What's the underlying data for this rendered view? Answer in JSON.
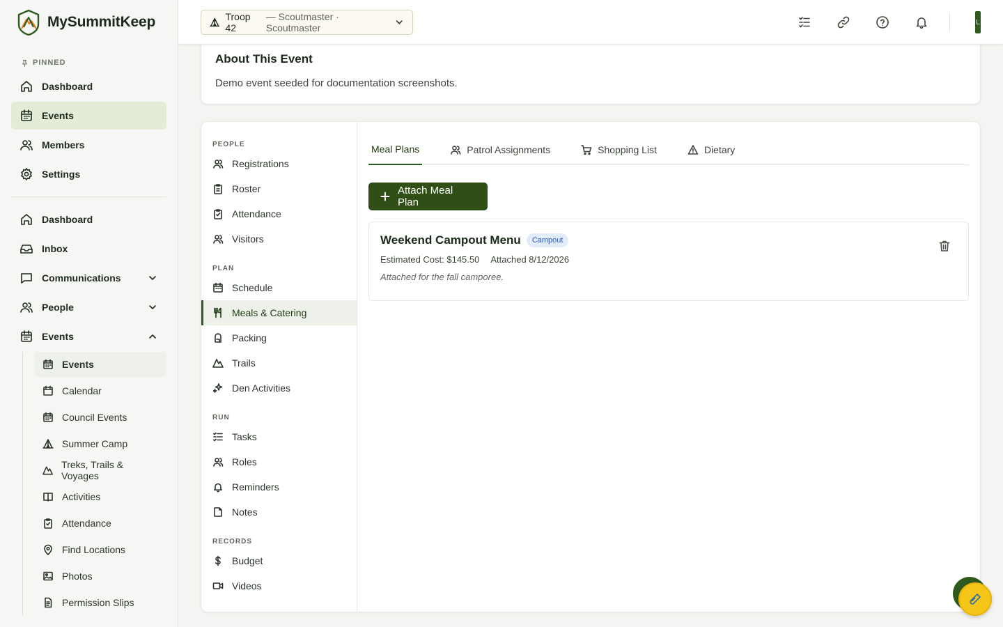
{
  "brand": {
    "name": "MySummitKeep"
  },
  "sidebar": {
    "pinned_label": "PINNED",
    "pinned": [
      {
        "label": "Dashboard",
        "icon": "home-icon"
      },
      {
        "label": "Events",
        "icon": "calendar-icon"
      },
      {
        "label": "Members",
        "icon": "users-icon"
      },
      {
        "label": "Settings",
        "icon": "gear-icon"
      }
    ],
    "main": [
      {
        "label": "Dashboard",
        "icon": "home-icon"
      },
      {
        "label": "Inbox",
        "icon": "inbox-icon"
      },
      {
        "label": "Communications",
        "icon": "message-icon"
      },
      {
        "label": "People",
        "icon": "users-icon"
      },
      {
        "label": "Events",
        "icon": "calendar-icon"
      }
    ],
    "events_sub": [
      {
        "label": "Events",
        "icon": "calendar-grid-icon"
      },
      {
        "label": "Calendar",
        "icon": "calendar-icon"
      },
      {
        "label": "Council Events",
        "icon": "calendar-grid-icon"
      },
      {
        "label": "Summer Camp",
        "icon": "tent-icon"
      },
      {
        "label": "Treks, Trails & Voyages",
        "icon": "mountain-icon"
      },
      {
        "label": "Activities",
        "icon": "book-icon"
      },
      {
        "label": "Attendance",
        "icon": "clipboard-check-icon"
      },
      {
        "label": "Find Locations",
        "icon": "map-pin-icon"
      },
      {
        "label": "Photos",
        "icon": "image-icon"
      },
      {
        "label": "Permission Slips",
        "icon": "document-icon"
      }
    ]
  },
  "topbar": {
    "troop": "Troop 42",
    "role": "— Scoutmaster · Scoutmaster",
    "avatar_initial": "L"
  },
  "about": {
    "title": "About This Event",
    "description": "Demo event seeded for documentation screenshots."
  },
  "event_nav": {
    "sections": [
      {
        "label": "PEOPLE",
        "items": [
          "Registrations",
          "Roster",
          "Attendance",
          "Visitors"
        ]
      },
      {
        "label": "PLAN",
        "items": [
          "Schedule",
          "Meals & Catering",
          "Packing",
          "Trails",
          "Den Activities"
        ]
      },
      {
        "label": "RUN",
        "items": [
          "Tasks",
          "Roles",
          "Reminders",
          "Notes"
        ]
      },
      {
        "label": "RECORDS",
        "items": [
          "Budget",
          "Videos"
        ]
      }
    ]
  },
  "tabs": [
    "Meal Plans",
    "Patrol Assignments",
    "Shopping List",
    "Dietary"
  ],
  "attach_button": "Attach Meal Plan",
  "meal_plan": {
    "title": "Weekend Campout Menu",
    "badge": "Campout",
    "cost": "Estimated Cost: $145.50",
    "attached": "Attached 8/12/2026",
    "note": "Attached for the fall camporee."
  },
  "colors": {
    "accent": "#2f4f17",
    "active_bg": "#e3ecd6",
    "badge_bg": "#e3ecf9",
    "fab": "#f5c518"
  }
}
